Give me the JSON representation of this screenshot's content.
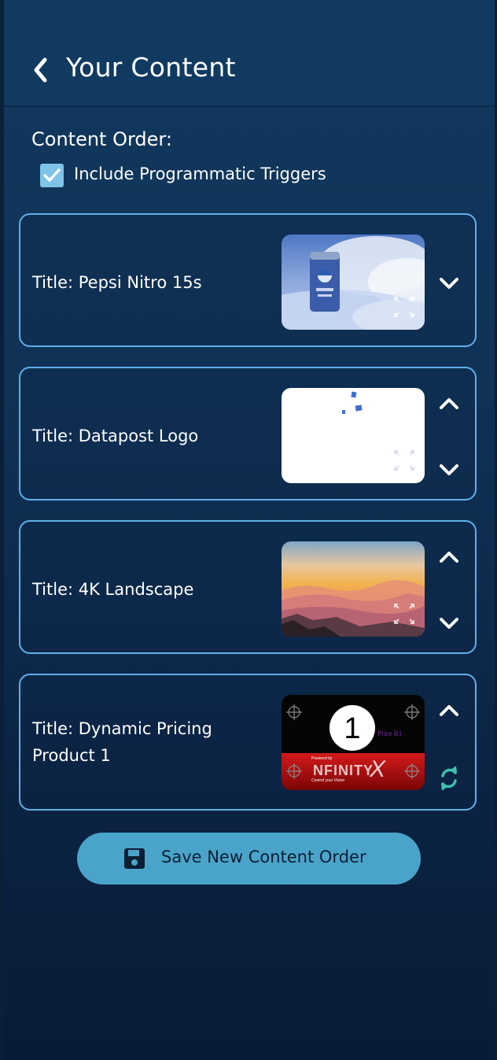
{
  "header": {
    "title": "Your Content",
    "back_icon": "chevron-left-icon"
  },
  "content_order": {
    "label": "Content Order:",
    "include_triggers": {
      "label": "Include Programmatic Triggers",
      "checked": true
    }
  },
  "items": [
    {
      "title": "Title: Pepsi   Nitro 15s",
      "thumbnail": "pepsi-nitro-can-in-clouds",
      "controls": [
        "chevron-down-icon"
      ]
    },
    {
      "title": "Title: Datapost Logo",
      "thumbnail": "datapost-logo-on-white",
      "controls": [
        "chevron-up-icon",
        "chevron-down-icon"
      ]
    },
    {
      "title": "Title: 4K Landscape",
      "thumbnail": "sunset-mountain-landscape",
      "controls": [
        "chevron-up-icon",
        "chevron-down-icon"
      ]
    },
    {
      "title": "Title: Dynamic Pricing Product 1",
      "thumbnail": "dynamic-pricing-preview",
      "thumbnail_text": {
        "number": "1",
        "price": "Price R1",
        "brand": "NFINITY",
        "brand_x": "X",
        "powered": "Powered by",
        "tagline": "Control   your Vision"
      },
      "controls": [
        "chevron-up-icon",
        "refresh-icon"
      ]
    }
  ],
  "save_button": {
    "label": "Save New Content Order",
    "icon": "floppy-disk-icon"
  },
  "colors": {
    "background": "#0f3155",
    "card_border": "#5fb0ea",
    "checkbox": "#7fc4e6",
    "save_button": "#4aa4c9",
    "refresh": "#3fbfae"
  }
}
